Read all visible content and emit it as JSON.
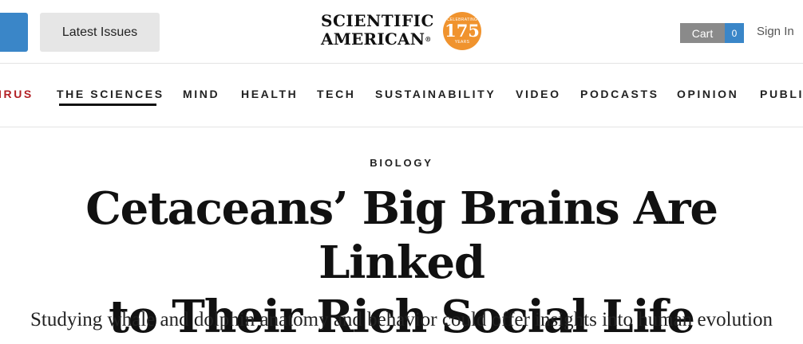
{
  "header": {
    "latest_issues": "Latest Issues",
    "logo_line1": "SCIENTIFIC",
    "logo_line2": "AMERICAN",
    "logo_trademark": "®",
    "badge_top": "CELEBRATING",
    "badge_number": "175",
    "badge_bottom": "YEARS",
    "cart_label": "Cart",
    "cart_count": "0",
    "sign_in": "Sign In"
  },
  "nav": {
    "items": [
      "IRUS",
      "THE SCIENCES",
      "MIND",
      "HEALTH",
      "TECH",
      "SUSTAINABILITY",
      "VIDEO",
      "PODCASTS",
      "OPINION",
      "PUBLI"
    ],
    "active": "THE SCIENCES"
  },
  "article": {
    "kicker": "BIOLOGY",
    "headline_line1": "Cetaceans’ Big Brains Are Linked",
    "headline_line2": "to Their Rich Social Life",
    "dek": "Studying whale and dolphin anatomy and behavior could offer insights into human evolution"
  },
  "colors": {
    "accent_blue": "#3a86c8",
    "coronavirus_red": "#b21f24",
    "badge_orange": "#f0932e",
    "cart_gray": "#8a8a8a"
  }
}
